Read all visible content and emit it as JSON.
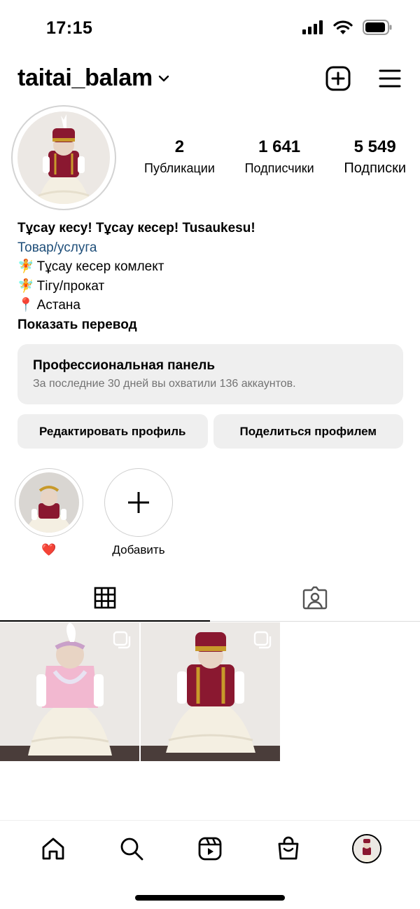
{
  "status": {
    "time": "17:15"
  },
  "header": {
    "username": "taitai_balam"
  },
  "stats": [
    {
      "value": "2",
      "label": "Публикации"
    },
    {
      "value": "1 641",
      "label": "Подписчики"
    },
    {
      "value": "5 549",
      "label": "Подписки"
    }
  ],
  "bio": {
    "name": "Тұсау кесу! Тұсау кесер! Tusaukesu!",
    "category": "Товар/услуга",
    "lines": [
      {
        "emoji": "🧚",
        "text": "Тұсау кесер комлект"
      },
      {
        "emoji": "🧚",
        "text": "Тігу/прокат"
      },
      {
        "emoji": "📍",
        "text": "Астана"
      }
    ],
    "translate": "Показать перевод"
  },
  "pro_panel": {
    "title": "Профессиональная панель",
    "subtitle": "За последние 30 дней вы охватили 136 аккаунтов."
  },
  "actions": {
    "edit_label": "Редактировать профиль",
    "share_label": "Поделиться профилем"
  },
  "highlights": [
    {
      "label": "❤️"
    },
    {
      "label": "Добавить"
    }
  ],
  "tabs": [
    {
      "icon": "grid-icon"
    },
    {
      "icon": "tagged-icon"
    }
  ],
  "nav": [
    {
      "icon": "home-icon"
    },
    {
      "icon": "search-icon"
    },
    {
      "icon": "reels-icon"
    },
    {
      "icon": "shop-icon"
    },
    {
      "icon": "profile-avatar"
    }
  ],
  "colors": {
    "accent_link": "#1e4e79",
    "panel_bg": "#efefef",
    "vest_red": "#8a1830",
    "embroidery_gold": "#c89a2a",
    "dress_cream": "#f4efe2",
    "vest_pink": "#f2b8d0"
  }
}
